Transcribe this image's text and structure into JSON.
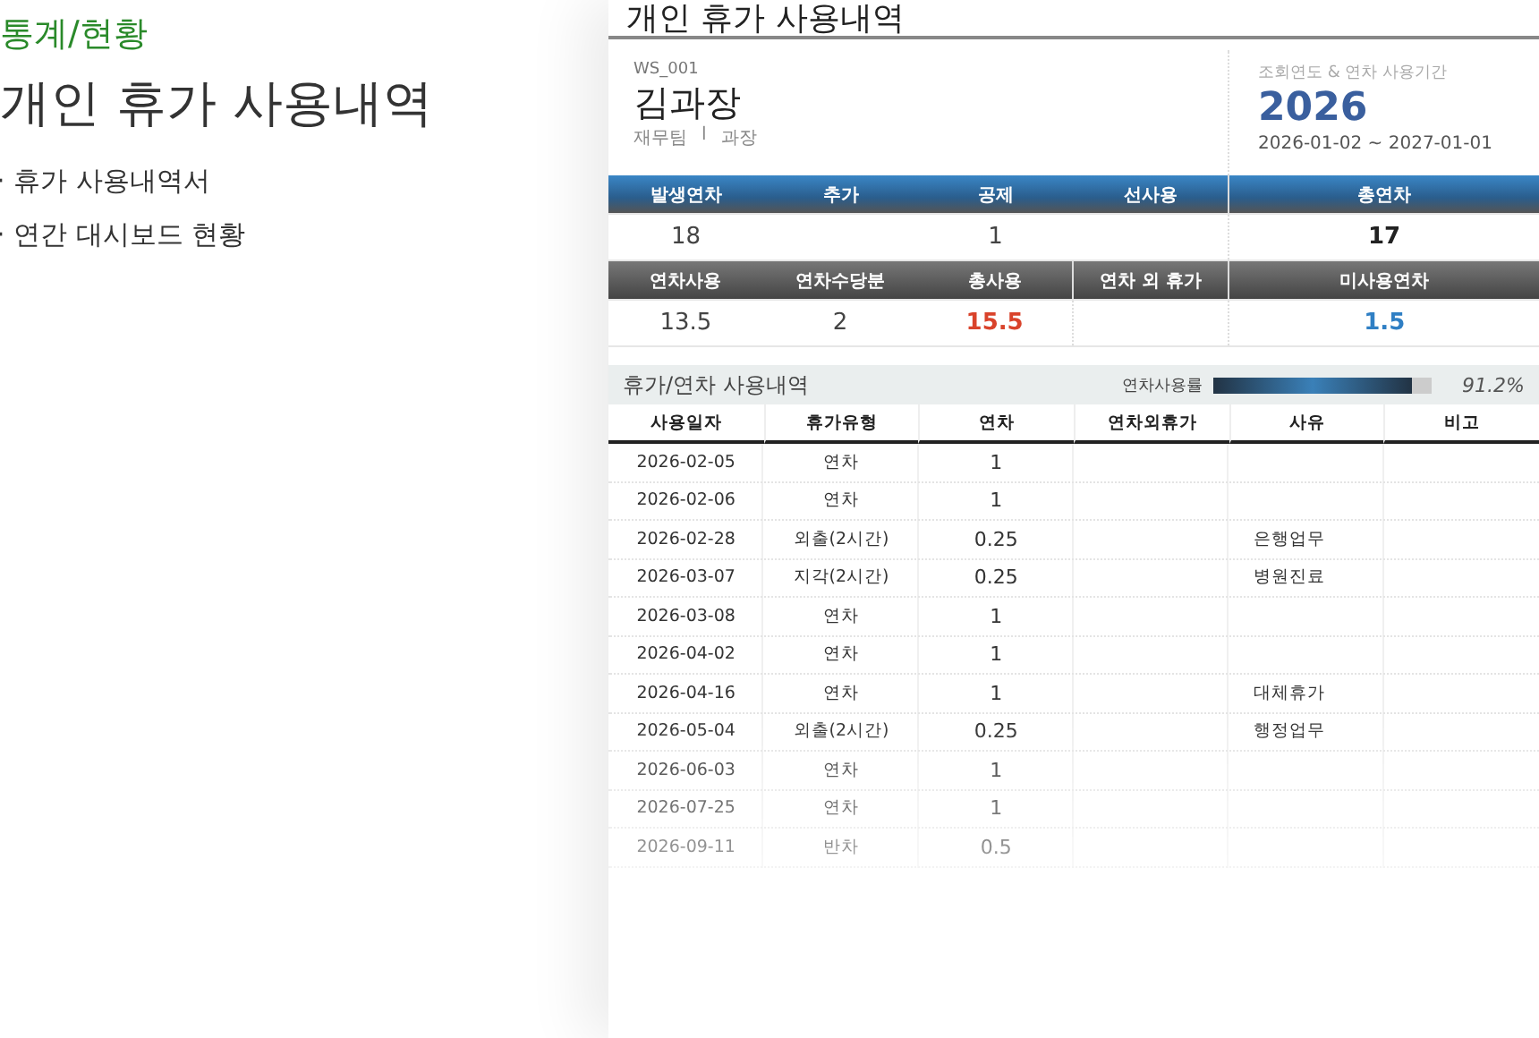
{
  "intro": {
    "category": "통계/현황",
    "title": "개인 휴가 사용내역",
    "bullets": [
      "· 휴가 사용내역서",
      "· 연간 대시보드 현황"
    ]
  },
  "sheet": {
    "title": "개인 휴가 사용내역",
    "employee": {
      "code": "WS_001",
      "name": "김과장",
      "department": "재무팀",
      "separator": "l",
      "position": "과장"
    },
    "period": {
      "label": "조회연도 & 연차 사용기간",
      "year": "2026",
      "range": "2026-01-02 ~ 2027-01-01"
    },
    "summary_rows": [
      {
        "kind": "blue",
        "cells": [
          {
            "label": "발생연차",
            "value": "18",
            "color": "#444444"
          },
          {
            "label": "추가"
          },
          {
            "label": "공제",
            "value": "1",
            "color": "#444444"
          },
          {
            "label": "선사용"
          }
        ],
        "total": {
          "label": "총연차",
          "value": "17",
          "color": "#222222"
        }
      },
      {
        "kind": "dark",
        "cells": [
          {
            "label": "연차사용",
            "value": "13.5",
            "color": "#444444"
          },
          {
            "label": "연차수당분",
            "value": "2",
            "color": "#444444"
          },
          {
            "label": "총사용",
            "value": "15.5",
            "color": "#d9432b"
          },
          {
            "label": "연차 외 휴가"
          }
        ],
        "total": {
          "label": "미사용연차",
          "value": "1.5",
          "color": "#2f7fc4"
        }
      }
    ],
    "history": {
      "title": "휴가/연차 사용내역",
      "usage_label": "연차사용률",
      "usage": {
        "level": 0.912,
        "reading": "91.2%"
      },
      "columns": [
        "사용일자",
        "휴가유형",
        "연차",
        "연차외휴가",
        "사유",
        "비고"
      ],
      "rows": [
        [
          "2026-02-05",
          "연차",
          "1",
          "",
          "",
          ""
        ],
        [
          "2026-02-06",
          "연차",
          "1",
          "",
          "",
          ""
        ],
        [
          "2026-02-28",
          "외출(2시간)",
          "0.25",
          "",
          "은행업무",
          ""
        ],
        [
          "2026-03-07",
          "지각(2시간)",
          "0.25",
          "",
          "병원진료",
          ""
        ],
        [
          "2026-03-08",
          "연차",
          "1",
          "",
          "",
          ""
        ],
        [
          "2026-04-02",
          "연차",
          "1",
          "",
          "",
          ""
        ],
        [
          "2026-04-16",
          "연차",
          "1",
          "",
          "대체휴가",
          ""
        ],
        [
          "2026-05-04",
          "외출(2시간)",
          "0.25",
          "",
          "행정업무",
          ""
        ],
        [
          "2026-06-03",
          "연차",
          "1",
          "",
          "",
          ""
        ],
        [
          "2026-07-25",
          "연차",
          "1",
          "",
          "",
          ""
        ],
        [
          "2026-09-11",
          "반차",
          "0.5",
          "",
          "",
          ""
        ]
      ]
    }
  }
}
